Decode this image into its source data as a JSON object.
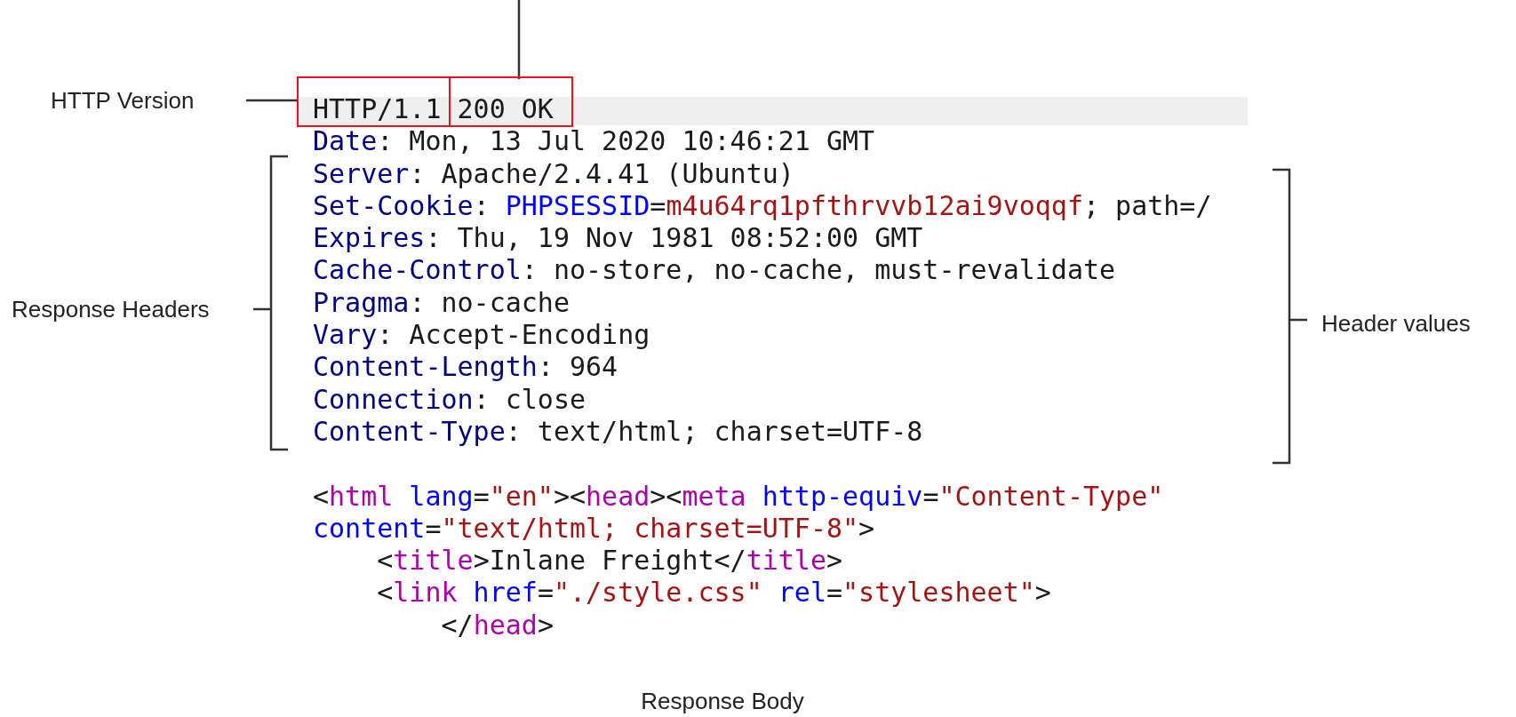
{
  "labels": {
    "http_version": "HTTP Version",
    "response_headers": "Response Headers",
    "header_values": "Header values",
    "response_body": "Response Body"
  },
  "status_line": {
    "version": "HTTP/1.1",
    "status": "200 OK"
  },
  "headers": [
    [
      {
        "kind": "name",
        "text": "Date"
      },
      {
        "kind": "plain",
        "text": ": Mon, 13 Jul 2020 10:46:21 GMT"
      }
    ],
    [
      {
        "kind": "name",
        "text": "Server"
      },
      {
        "kind": "plain",
        "text": ": Apache/2.4.41 (Ubuntu)"
      }
    ],
    [
      {
        "kind": "name",
        "text": "Set-Cookie"
      },
      {
        "kind": "plain",
        "text": ": "
      },
      {
        "kind": "key",
        "text": "PHPSESSID"
      },
      {
        "kind": "plain",
        "text": "="
      },
      {
        "kind": "string",
        "text": "m4u64rq1pfthrvvb12ai9voqqf"
      },
      {
        "kind": "plain",
        "text": "; path=/"
      }
    ],
    [
      {
        "kind": "name",
        "text": "Expires"
      },
      {
        "kind": "plain",
        "text": ": Thu, 19 Nov 1981 08:52:00 GMT"
      }
    ],
    [
      {
        "kind": "name",
        "text": "Cache-Control"
      },
      {
        "kind": "plain",
        "text": ": no-store, no-cache, must-revalidate"
      }
    ],
    [
      {
        "kind": "name",
        "text": "Pragma"
      },
      {
        "kind": "plain",
        "text": ": no-cache"
      }
    ],
    [
      {
        "kind": "name",
        "text": "Vary"
      },
      {
        "kind": "plain",
        "text": ": Accept-Encoding"
      }
    ],
    [
      {
        "kind": "name",
        "text": "Content-Length"
      },
      {
        "kind": "plain",
        "text": ": 964"
      }
    ],
    [
      {
        "kind": "name",
        "text": "Connection"
      },
      {
        "kind": "plain",
        "text": ": close"
      }
    ],
    [
      {
        "kind": "name",
        "text": "Content-Type"
      },
      {
        "kind": "plain",
        "text": ": text/html; charset=UTF-8"
      }
    ]
  ],
  "body": [
    [
      {
        "kind": "plain",
        "text": "<"
      },
      {
        "kind": "tag",
        "text": "html"
      },
      {
        "kind": "attr",
        "text": " lang"
      },
      {
        "kind": "plain",
        "text": "="
      },
      {
        "kind": "string",
        "text": "\"en\""
      },
      {
        "kind": "plain",
        "text": "><"
      },
      {
        "kind": "tag",
        "text": "head"
      },
      {
        "kind": "plain",
        "text": "><"
      },
      {
        "kind": "tag",
        "text": "meta"
      },
      {
        "kind": "attr",
        "text": " http-equiv"
      },
      {
        "kind": "plain",
        "text": "="
      },
      {
        "kind": "string",
        "text": "\"Content-Type\""
      }
    ],
    [
      {
        "kind": "attr",
        "text": "content"
      },
      {
        "kind": "plain",
        "text": "="
      },
      {
        "kind": "string",
        "text": "\"text/html; charset=UTF-8\""
      },
      {
        "kind": "plain",
        "text": ">"
      }
    ],
    [
      {
        "kind": "plain",
        "text": "    <"
      },
      {
        "kind": "tag",
        "text": "title"
      },
      {
        "kind": "plain",
        "text": ">Inlane Freight</"
      },
      {
        "kind": "tag",
        "text": "title"
      },
      {
        "kind": "plain",
        "text": ">"
      }
    ],
    [
      {
        "kind": "plain",
        "text": "    <"
      },
      {
        "kind": "tag",
        "text": "link"
      },
      {
        "kind": "attr",
        "text": " href"
      },
      {
        "kind": "plain",
        "text": "="
      },
      {
        "kind": "string",
        "text": "\"./style.css\""
      },
      {
        "kind": "attr",
        "text": " rel"
      },
      {
        "kind": "plain",
        "text": "="
      },
      {
        "kind": "string",
        "text": "\"stylesheet\""
      },
      {
        "kind": "plain",
        "text": ">"
      }
    ],
    [
      {
        "kind": "plain",
        "text": "        </"
      },
      {
        "kind": "tag",
        "text": "head"
      },
      {
        "kind": "plain",
        "text": ">"
      }
    ]
  ]
}
